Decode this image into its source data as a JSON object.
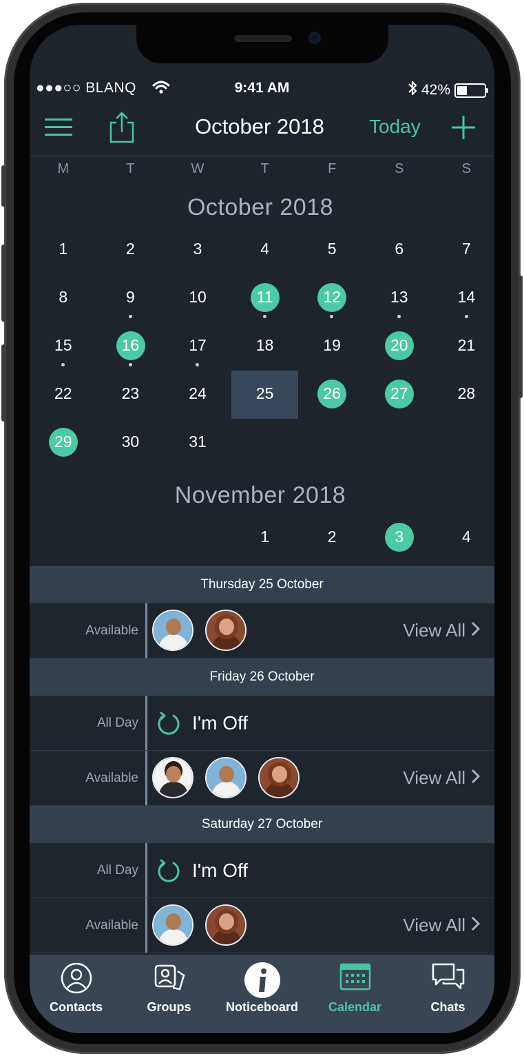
{
  "status": {
    "carrier": "●●●○○ BLANQ",
    "time": "9:41 AM",
    "battery": "42%",
    "battery_level": 0.42
  },
  "nav": {
    "menu_icon": "hamburger-icon",
    "share_icon": "share-icon",
    "title": "October 2018",
    "today": "Today",
    "add_icon": "plus-icon"
  },
  "weekdays": [
    "M",
    "T",
    "W",
    "T",
    "F",
    "S",
    "S"
  ],
  "calendar": {
    "accent": "#4cc9a5",
    "months": [
      {
        "title": "October 2018",
        "weeks": [
          [
            {
              "d": "1"
            },
            {
              "d": "2"
            },
            {
              "d": "3"
            },
            {
              "d": "4"
            },
            {
              "d": "5"
            },
            {
              "d": "6"
            },
            {
              "d": "7"
            }
          ],
          [
            {
              "d": "8"
            },
            {
              "d": "9",
              "dot": true
            },
            {
              "d": "10"
            },
            {
              "d": "11",
              "circle": true,
              "dot": true
            },
            {
              "d": "12",
              "circle": true,
              "dot": true
            },
            {
              "d": "13",
              "dot": true
            },
            {
              "d": "14",
              "dot": true
            }
          ],
          [
            {
              "d": "15",
              "dot": true
            },
            {
              "d": "16",
              "circle": true,
              "dot": true
            },
            {
              "d": "17",
              "dot": true
            },
            {
              "d": "18"
            },
            {
              "d": "19"
            },
            {
              "d": "20",
              "circle": true
            },
            {
              "d": "21"
            }
          ],
          [
            {
              "d": "22"
            },
            {
              "d": "23"
            },
            {
              "d": "24"
            },
            {
              "d": "25",
              "selected": true
            },
            {
              "d": "26",
              "circle": true
            },
            {
              "d": "27",
              "circle": true
            },
            {
              "d": "28"
            }
          ],
          [
            {
              "d": "29",
              "circle": true
            },
            {
              "d": "30"
            },
            {
              "d": "31"
            },
            null,
            null,
            null,
            null
          ]
        ]
      },
      {
        "title": "November 2018",
        "weeks": [
          [
            null,
            null,
            null,
            {
              "d": "1"
            },
            {
              "d": "2"
            },
            {
              "d": "3",
              "circle": true
            },
            {
              "d": "4"
            }
          ],
          [
            null,
            {
              "d": "",
              "circle": true
            },
            null,
            null,
            {
              "d": "",
              "circle": true
            },
            null,
            null
          ]
        ]
      }
    ]
  },
  "agenda": [
    {
      "header": "Thursday 25 October",
      "rows": [
        {
          "type": "available",
          "label": "Available",
          "avatars": [
            "man-bald",
            "woman-red"
          ],
          "view_all": "View All"
        }
      ]
    },
    {
      "header": "Friday 26 October",
      "rows": [
        {
          "type": "off",
          "label": "All Day",
          "text": "I'm Off"
        },
        {
          "type": "available",
          "label": "Available",
          "avatars": [
            "man-curly",
            "man-bald",
            "woman-red"
          ],
          "view_all": "View All"
        }
      ]
    },
    {
      "header": "Saturday 27 October",
      "rows": [
        {
          "type": "off",
          "label": "All Day",
          "text": "I'm Off"
        },
        {
          "type": "available",
          "label": "Available",
          "avatars": [
            "man-bald",
            "woman-red"
          ],
          "view_all": "View All"
        }
      ]
    }
  ],
  "tabs": [
    {
      "label": "Contacts",
      "icon": "contact-icon",
      "active": false
    },
    {
      "label": "Groups",
      "icon": "groups-icon",
      "active": false
    },
    {
      "label": "Noticeboard",
      "icon": "info-icon",
      "active": false
    },
    {
      "label": "Calendar",
      "icon": "calendar-icon",
      "active": true
    },
    {
      "label": "Chats",
      "icon": "chats-icon",
      "active": false
    }
  ],
  "colors": {
    "accent": "#49c5a3",
    "background": "#1e242c",
    "header": "#35404e",
    "tabbar": "#3a4553"
  }
}
